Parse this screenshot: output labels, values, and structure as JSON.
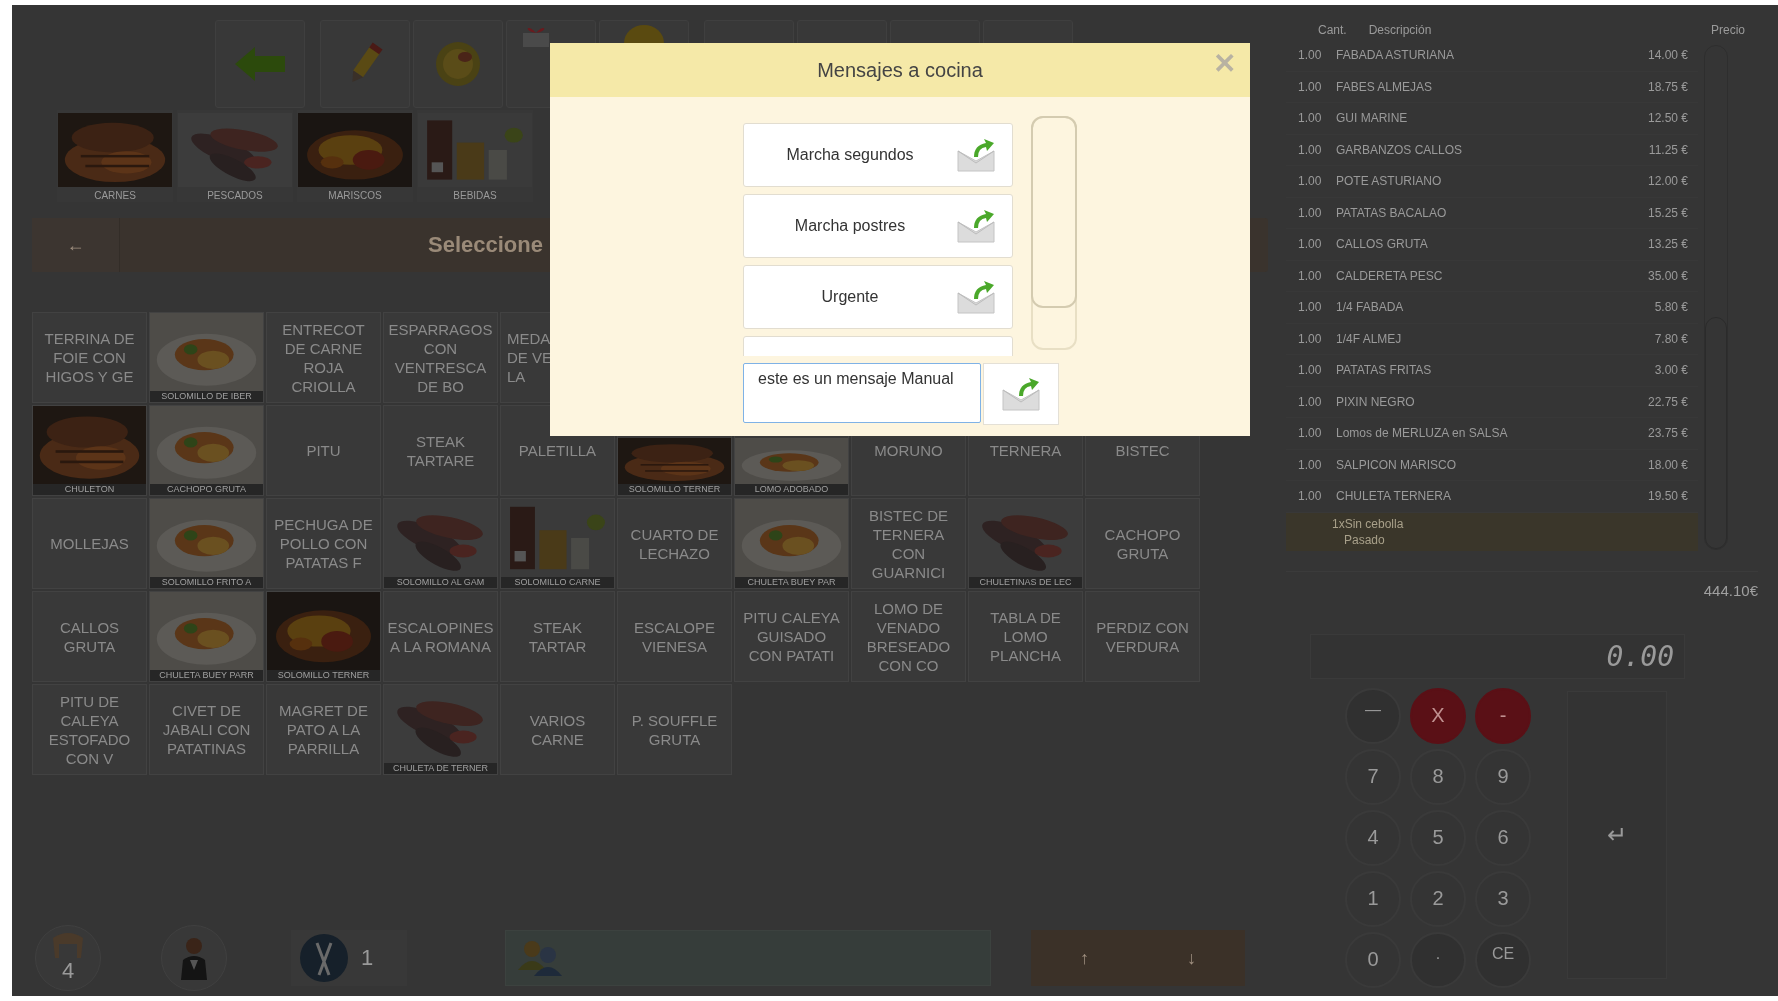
{
  "toolbar": {
    "buttons": [
      {
        "kind": "back"
      },
      {
        "kind": "pencil"
      },
      {
        "kind": "plate"
      },
      {
        "kind": "gift"
      },
      {
        "kind": "coin"
      },
      {
        "kind": "blank"
      },
      {
        "kind": "blank"
      },
      {
        "kind": "blank"
      },
      {
        "kind": "blank"
      }
    ]
  },
  "categories": [
    {
      "label": "CARNES"
    },
    {
      "label": "PESCADOS"
    },
    {
      "label": "MARISCOS"
    },
    {
      "label": "BEBIDAS"
    }
  ],
  "header": {
    "back": "←",
    "title": "Seleccione"
  },
  "grid": {
    "rows": [
      [
        {
          "kind": "text",
          "label": "TERRINA DE FOIE CON HIGOS Y GE"
        },
        {
          "caption": "SOLOMILLO DE IBER"
        },
        {
          "kind": "text",
          "label": "ENTRECOT DE CARNE ROJA CRIOLLA"
        },
        {
          "kind": "text",
          "label": "ESPARRAGOS CON VENTRESCA DE BO"
        },
        {
          "kind": "cut",
          "lines": [
            "MEDA",
            "DE VE",
            "LA"
          ]
        }
      ],
      [
        {
          "caption": "CHULETON"
        },
        {
          "caption": "CACHOPO GRUTA"
        },
        {
          "kind": "text",
          "label": "PITU"
        },
        {
          "kind": "text",
          "label": "STEAK TARTARE"
        },
        {
          "kind": "text",
          "label": "PALETILLA"
        },
        {
          "caption": "SOLOMILLO TERNER"
        },
        {
          "caption": "LOMO ADOBADO"
        },
        {
          "kind": "text",
          "label": "MORUNO"
        },
        {
          "kind": "text",
          "label": "TERNERA"
        },
        {
          "kind": "text",
          "label": "BISTEC"
        }
      ],
      [
        {
          "kind": "text",
          "label": "MOLLEJAS"
        },
        {
          "caption": "SOLOMILLO FRITO A"
        },
        {
          "kind": "text",
          "label": "PECHUGA DE POLLO CON PATATAS F"
        },
        {
          "caption": "SOLOMILLO AL GAM"
        },
        {
          "caption": "SOLOMILLO CARNE"
        },
        {
          "kind": "text",
          "label": "CUARTO DE LECHAZO"
        },
        {
          "caption": "CHULETA BUEY PAR"
        },
        {
          "kind": "text",
          "label": "BISTEC DE TERNERA CON GUARNICI"
        },
        {
          "caption": "CHULETINAS DE LEC"
        },
        {
          "kind": "text",
          "label": "CACHOPO GRUTA"
        }
      ],
      [
        {
          "kind": "text",
          "label": "CALLOS GRUTA"
        },
        {
          "caption": "CHULETA BUEY PARR"
        },
        {
          "caption": "SOLOMILLO TERNER"
        },
        {
          "kind": "text",
          "label": "ESCALOPINES A LA ROMANA"
        },
        {
          "kind": "text",
          "label": "STEAK TARTAR"
        },
        {
          "kind": "text",
          "label": "ESCALOPE VIENESA"
        },
        {
          "kind": "text",
          "label": "PITU CALEYA GUISADO CON PATATI"
        },
        {
          "kind": "text",
          "label": "LOMO DE VENADO BRESEADO CON CO"
        },
        {
          "kind": "text",
          "label": "TABLA DE LOMO PLANCHA"
        },
        {
          "kind": "text",
          "label": "PERDIZ CON VERDURA"
        }
      ],
      [
        {
          "kind": "text",
          "label": "PITU DE CALEYA ESTOFADO CON V"
        },
        {
          "kind": "text",
          "label": "CIVET DE JABALI CON PATATINAS"
        },
        {
          "kind": "text",
          "label": "MAGRET DE PATO A LA PARRILLA"
        },
        {
          "caption": "CHULETA DE TERNER"
        },
        {
          "kind": "text",
          "label": "VARIOS CARNE"
        },
        {
          "kind": "text",
          "label": "P. SOUFFLE GRUTA"
        }
      ]
    ]
  },
  "bottom_bar": {
    "diners": "4",
    "courses": "1",
    "up": "↑",
    "down": "↓"
  },
  "order": {
    "columns": [
      "Cant.",
      "Descripción",
      "Precio"
    ],
    "rows": [
      {
        "qty": "1.00",
        "description": "FABADA ASTURIANA",
        "price": "14.00 €"
      },
      {
        "qty": "1.00",
        "description": "FABES ALMEJAS",
        "price": "18.75 €"
      },
      {
        "qty": "1.00",
        "description": "GUI MARINE",
        "price": "12.50 €"
      },
      {
        "qty": "1.00",
        "description": "GARBANZOS CALLOS",
        "price": "11.25 €"
      },
      {
        "qty": "1.00",
        "description": "POTE ASTURIANO",
        "price": "12.00 €"
      },
      {
        "qty": "1.00",
        "description": "PATATAS BACALAO",
        "price": "15.25 €"
      },
      {
        "qty": "1.00",
        "description": "CALLOS GRUTA",
        "price": "13.25 €"
      },
      {
        "qty": "1.00",
        "description": "CALDERETA PESC",
        "price": "35.00 €"
      },
      {
        "qty": "1.00",
        "description": "1/4 FABADA",
        "price": "5.80 €"
      },
      {
        "qty": "1.00",
        "description": "1/4F ALMEJ",
        "price": "7.80 €"
      },
      {
        "qty": "1.00",
        "description": "PATATAS FRITAS",
        "price": "3.00 €"
      },
      {
        "qty": "1.00",
        "description": "PIXIN NEGRO",
        "price": "22.75 €"
      },
      {
        "qty": "1.00",
        "description": "Lomos de MERLUZA en SALSA",
        "price": "23.75 €"
      },
      {
        "qty": "1.00",
        "description": "SALPICON MARISCO",
        "price": "18.00 €"
      },
      {
        "qty": "1.00",
        "description": "CHULETA TERNERA",
        "price": "19.50 €"
      }
    ],
    "notes": [
      "1xSin cebolla",
      "Pasado"
    ],
    "total": "444.10€"
  },
  "keypad": {
    "display": "0.00",
    "keys": [
      {
        "kind": "gray",
        "label": "—"
      },
      {
        "kind": "red",
        "label": "X"
      },
      {
        "kind": "red",
        "label": "-"
      },
      {
        "kind": "digit",
        "label": "7"
      },
      {
        "kind": "digit",
        "label": "8"
      },
      {
        "kind": "digit",
        "label": "9"
      },
      {
        "kind": "digit",
        "label": "4"
      },
      {
        "kind": "digit",
        "label": "5"
      },
      {
        "kind": "digit",
        "label": "6"
      },
      {
        "kind": "digit",
        "label": "1"
      },
      {
        "kind": "digit",
        "label": "2"
      },
      {
        "kind": "digit",
        "label": "3"
      },
      {
        "kind": "digit",
        "label": "0"
      },
      {
        "kind": "gray",
        "label": "."
      },
      {
        "kind": "gray",
        "label": "CE"
      }
    ],
    "enter": "↵"
  },
  "dialog": {
    "title": "Mensajes a cocina",
    "close": "✕",
    "messages": [
      {
        "label": "Marcha segundos"
      },
      {
        "label": "Marcha postres"
      },
      {
        "label": "Urgente"
      }
    ],
    "input": {
      "value": "este es un mensaje Manual"
    }
  }
}
